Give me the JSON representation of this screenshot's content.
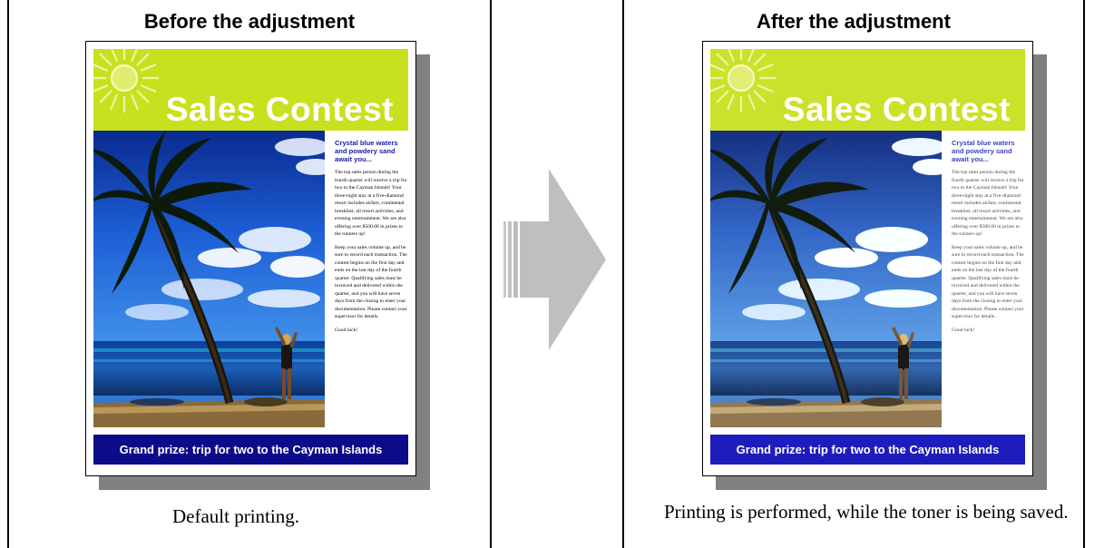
{
  "before": {
    "title": "Before the adjustment",
    "caption": "Default printing."
  },
  "after": {
    "title": "After the adjustment",
    "caption": "Printing is performed, while the toner is being saved."
  },
  "poster": {
    "headline": "Sales Contest",
    "side_heading": "Crystal blue waters and powdery sand await you...",
    "paragraph_1": "The top sales person during the fourth quarter will receive a trip for two to the Cayman Islands! Your three-night stay at a five-diamond resort includes airfare, continental breakfast, all resort activities, and evening entertainment. We are also offering over $500.00 in prizes to the runners up!",
    "paragraph_2": "Keep your sales volume up, and be sure to record each transaction. The contest begins on the first day and ends on the last day of the fourth quarter. Qualifying sales must be invoiced and delivered within the quarter, and you will have seven days from the closing to enter your documentation. Please contact your supervisor for details.",
    "closing": "Good luck!",
    "prize": "Grand prize: trip for two to the Cayman Islands"
  },
  "colors": {
    "banner": "#c8e11e",
    "prize_bar_before": "#0c0c8a",
    "prize_bar_after": "#1d1dbd",
    "shadow": "#808080",
    "arrow": "#c0c0c0"
  },
  "icons": {
    "arrow": "right-arrow-icon",
    "sun": "sun-icon"
  }
}
